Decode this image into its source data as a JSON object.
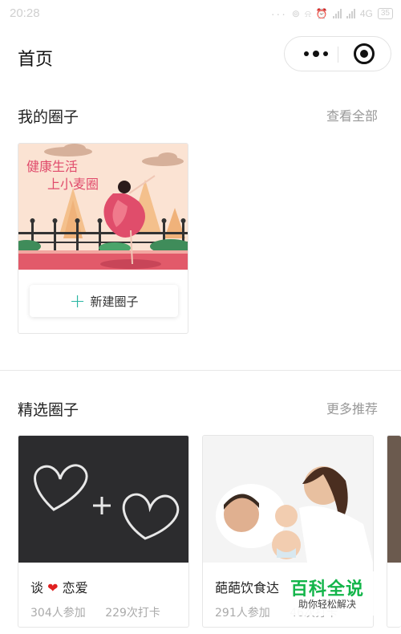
{
  "status_bar": {
    "time": "20:28",
    "network": "4G",
    "battery": "35"
  },
  "header": {
    "title": "首页"
  },
  "my_circles": {
    "title": "我的圈子",
    "view_all": "查看全部",
    "cover_text_line1": "健康生活",
    "cover_text_line2": "上小麦圈",
    "new_button": "新建圈子",
    "plus": "+"
  },
  "featured": {
    "title": "精选圈子",
    "more": "更多推荐",
    "items": [
      {
        "name_before": "谈",
        "emoji": "❤",
        "name_after": "恋爱",
        "members": "304人参加",
        "checkins": "229次打卡"
      },
      {
        "name_before": "葩葩饮食达",
        "emoji": "",
        "name_after": "",
        "members": "291人参加",
        "checkins": "46次打卡"
      }
    ]
  },
  "watermark": {
    "brand": "百科全说",
    "slogan": "助你轻松解决"
  },
  "colors": {
    "accent": "#2bb6a3",
    "brand_green": "#13b54a",
    "heart": "#e02020"
  }
}
